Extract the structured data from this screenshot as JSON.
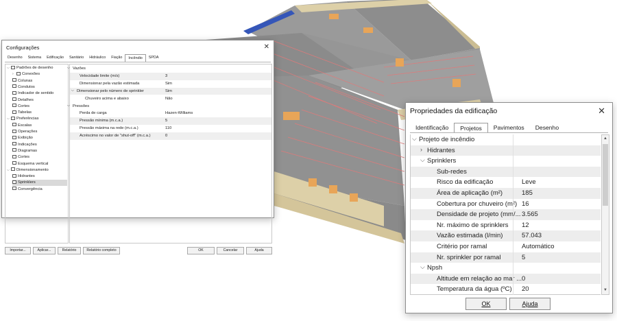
{
  "config_window": {
    "title": "Configurações",
    "tabs": [
      "Desenho",
      "Sistema",
      "Edificação",
      "Sanitário",
      "Hidráulico",
      "Fiação",
      "Incêndio",
      "SPDA"
    ],
    "active_tab": "Incêndio",
    "tree": [
      {
        "label": "Padrões de desenho",
        "arrow": "v"
      },
      {
        "label": "Conexões",
        "arrow": ">"
      },
      {
        "label": "Colunas"
      },
      {
        "label": "Condutos"
      },
      {
        "label": "Indicador de sentido"
      },
      {
        "label": "Detalhes"
      },
      {
        "label": "Cortes"
      },
      {
        "label": "Tabelas"
      },
      {
        "label": "Preferências",
        "arrow": "v"
      },
      {
        "label": "Escalas"
      },
      {
        "label": "Operações"
      },
      {
        "label": "Exibição"
      },
      {
        "label": "Indicações"
      },
      {
        "label": "Diagramas"
      },
      {
        "label": "Cortes"
      },
      {
        "label": "Esquema vertical"
      },
      {
        "label": "Dimensionamento",
        "arrow": "v"
      },
      {
        "label": "Hidrantes"
      },
      {
        "label": "Sprinklers",
        "selected": true
      },
      {
        "label": "Convergência"
      }
    ],
    "grid": [
      {
        "label": "Vazões",
        "arrow": "v",
        "type": "category"
      },
      {
        "label": "Velocidade limite (m/s)",
        "value": "3"
      },
      {
        "label": "Dimensionar pela vazão estimada",
        "value": "Sim"
      },
      {
        "label": "Dimensionar pelo número de sprinkler",
        "value": "Sim",
        "arrow": "v"
      },
      {
        "label": "Chuveiro acima e abaixo",
        "value": "Não"
      },
      {
        "label": "Pressões",
        "arrow": "v",
        "type": "category"
      },
      {
        "label": "Perda de carga",
        "value": "Hazen-Williams"
      },
      {
        "label": "Pressão mínima (m.c.a.)",
        "value": "5"
      },
      {
        "label": "Pressão máxima na rede (m.c.a.)",
        "value": "110"
      },
      {
        "label": "Acréscimo no valor de \"shut-off\" (m.c.a.)",
        "value": "0"
      }
    ],
    "buttons": {
      "importar": "Importar...",
      "aplicar": "Aplicar...",
      "relatorio": "Relatório",
      "relatorio_completo": "Relatório completo",
      "ok": "OK",
      "cancelar": "Cancelar",
      "ajuda": "Ajuda"
    }
  },
  "props_window": {
    "title": "Propriedades da edificação",
    "tabs": [
      "Identificação",
      "Projetos",
      "Pavimentos",
      "Desenho"
    ],
    "active_tab": "Projetos",
    "rows": [
      {
        "label": "Projeto de incêndio",
        "arrow": "v",
        "type": "category"
      },
      {
        "label": "Hidrantes",
        "arrow": ">",
        "type": "category"
      },
      {
        "label": "Sprinklers",
        "arrow": "v",
        "type": "category"
      },
      {
        "label": "Sub-redes",
        "value": ""
      },
      {
        "label": "Risco da edificação",
        "value": "Leve"
      },
      {
        "label": "Área de aplicação (m²)",
        "value": "185"
      },
      {
        "label": "Cobertura por chuveiro (m²)",
        "value": "16"
      },
      {
        "label": "Densidade de projeto (mm/...",
        "value": "3.565"
      },
      {
        "label": "Nr. máximo de sprinklers",
        "value": "12"
      },
      {
        "label": "Vazão estimada (l/min)",
        "value": "57.043"
      },
      {
        "label": "Critério por ramal",
        "value": "Automático"
      },
      {
        "label": "Nr. sprinkler por ramal",
        "value": "5"
      },
      {
        "label": "Npsh",
        "arrow": "v",
        "type": "category"
      },
      {
        "label": "Altitude em relação ao mar ...",
        "value": "0"
      },
      {
        "label": "Temperatura da água (ºC)",
        "value": "20"
      }
    ],
    "buttons": {
      "ok": "OK",
      "ajuda": "Ajuda"
    }
  },
  "colors": {
    "roof": "#8f8f8f",
    "wall": "#ddd0a8",
    "window": "#e8a558",
    "pipe": "#e07a7a",
    "blue_strip": "#3556b8"
  }
}
